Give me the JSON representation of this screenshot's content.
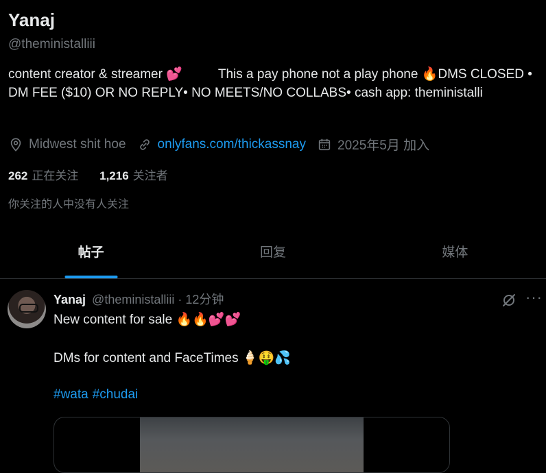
{
  "profile": {
    "name": "Yanaj",
    "handle": "@theministalliii",
    "bio_part1": "content creator & streamer 💕",
    "bio_part2": "This a pay phone not a play phone 🔥DMS CLOSED • DM FEE ($10) OR NO REPLY• NO MEETS/NO COLLABS• cash app: theministalli",
    "location": "Midwest shit hoe",
    "link": "onlyfans.com/thickassnay",
    "joined": "2025年5月 加入",
    "following_count": "262",
    "following_label": "正在关注",
    "followers_count": "1,216",
    "followers_label": "关注者",
    "mutual_note": "你关注的人中没有人关注"
  },
  "tabs": [
    {
      "label": "帖子",
      "active": true
    },
    {
      "label": "回复",
      "active": false
    },
    {
      "label": "媒体",
      "active": false
    }
  ],
  "post": {
    "name": "Yanaj",
    "handle": "@theministalliii",
    "time": "· 12分钟",
    "text1": "New content for sale 🔥🔥💕💕",
    "text2": "DMs for content and FaceTimes 🍦🤑💦",
    "hashtags": [
      "#wata",
      "#chudai"
    ],
    "more_label": "···"
  },
  "colors": {
    "background": "#000000",
    "text": "#e7e9ea",
    "secondary": "#71767b",
    "accent": "#1d9bf0",
    "border": "#2f3336"
  },
  "icons": {
    "location": "location-pin-icon",
    "link": "link-icon",
    "calendar": "calendar-icon",
    "grok": "grok-icon",
    "more": "more-icon"
  }
}
